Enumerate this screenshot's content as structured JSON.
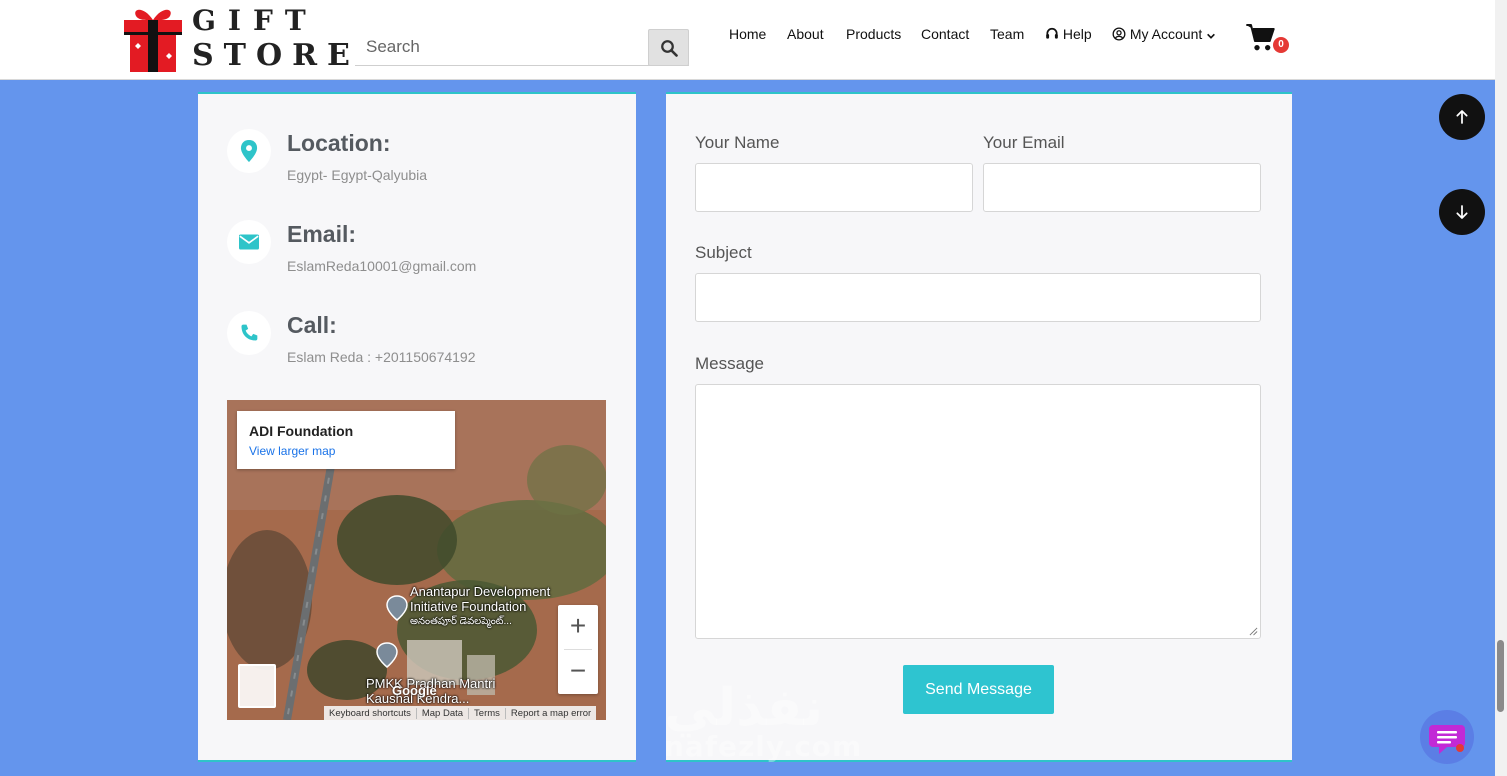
{
  "header": {
    "logo": {
      "line1": "GIFT",
      "line2": "STORE"
    },
    "search": {
      "placeholder": "Search"
    },
    "nav": {
      "home": "Home",
      "about": "About",
      "products": "Products",
      "contact": "Contact",
      "team": "Team",
      "help": "Help",
      "account": "My Account"
    },
    "cart_count": "0"
  },
  "contact_info": {
    "location_title": "Location:",
    "location_value": "Egypt- Egypt-Qalyubia",
    "email_title": "Email:",
    "email_value": "EslamReda10001@gmail.com",
    "call_title": "Call:",
    "call_value": "Eslam Reda : +201150674192"
  },
  "map": {
    "place_name": "ADI Foundation",
    "larger_map_link": "View larger map",
    "label_1": "Anantapur Development Initiative Foundation",
    "label_1_native": "అనంతపూర్ డెవలప్మెంట్...",
    "label_2": "PMKK Pradhan Mantri Kaushal Kendra...",
    "google": "Google",
    "zoom_in": "+",
    "zoom_out": "−",
    "footer": [
      "Keyboard shortcuts",
      "Map Data",
      "Terms",
      "Report a map error"
    ]
  },
  "form": {
    "name_label": "Your Name",
    "email_label": "Your Email",
    "subject_label": "Subject",
    "message_label": "Message",
    "submit_label": "Send Message"
  },
  "watermark": {
    "arabic": "نفذلي",
    "latin": "nafezly.com"
  },
  "colors": {
    "page_bg": "#6495ed",
    "accent": "#2ec4c9",
    "logo_red": "#e31b23",
    "badge_red": "#e53935"
  },
  "icons": {
    "search": "search-icon",
    "location": "map-marker-icon",
    "email": "envelope-icon",
    "call": "phone-icon",
    "cart": "shopping-cart-icon",
    "help": "headset-icon",
    "account": "user-circle-icon",
    "scroll_up": "arrow-up-icon",
    "scroll_down": "arrow-down-icon",
    "chat": "chat-icon"
  }
}
